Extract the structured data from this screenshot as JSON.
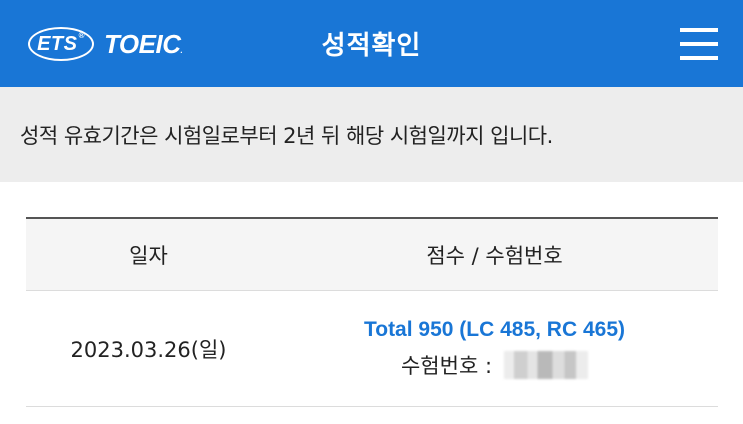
{
  "header": {
    "logo_ets": "ETS",
    "logo_reg": "®",
    "logo_toeic": "TOEIC",
    "logo_dot": ".",
    "title": "성적확인",
    "menu_icon": "hamburger-menu-icon"
  },
  "notice": {
    "text": "성적 유효기간은 시험일로부터 2년 뒤 해당 시험일까지 입니다."
  },
  "table": {
    "headers": [
      "일자",
      "점수 / 수험번호"
    ],
    "rows": [
      {
        "date": "2023.03.26(일)",
        "score": "Total 950 (LC 485, RC 465)",
        "reg_label": "수험번호 :"
      }
    ]
  },
  "colors": {
    "brand_blue": "#1976d6",
    "notice_bg": "#ededed",
    "header_row_bg": "#f5f5f5"
  }
}
